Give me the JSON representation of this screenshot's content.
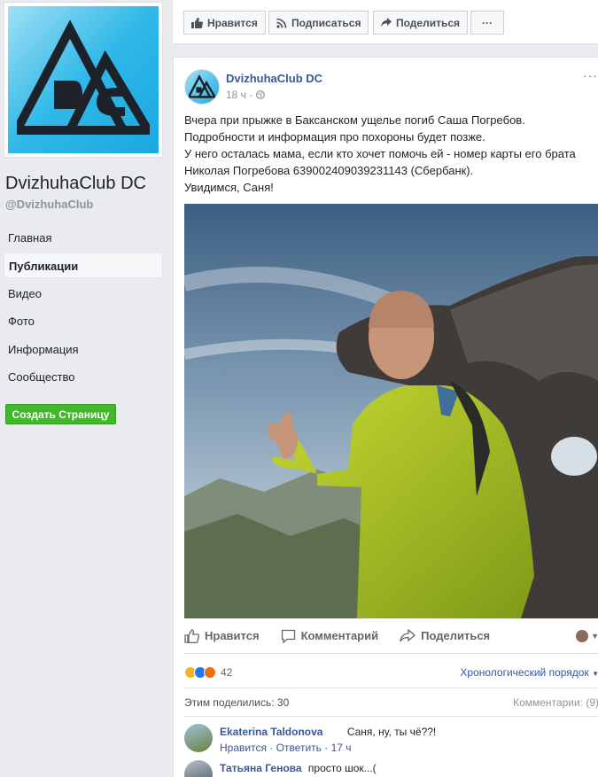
{
  "sidebar": {
    "page_name": "DvizhuhaClub DC",
    "handle": "@DvizhuhaClub",
    "nav": [
      "Главная",
      "Публикации",
      "Видео",
      "Фото",
      "Информация",
      "Сообщество"
    ],
    "active_index": 1,
    "create_label": "Создать Страницу"
  },
  "actions": {
    "like": "Нравится",
    "follow": "Подписаться",
    "share": "Поделиться",
    "more": "···"
  },
  "post": {
    "author": "DvizhuhaClub DC",
    "time": "18 ч ·",
    "lines": [
      "Вчера при прыжке в Баксанском ущелье погиб Саша Погребов.",
      "Подробности и информация про похороны будет позже.",
      "У него осталась мама, если кто хочет помочь ей - номер карты его брата",
      "Николая Погребова 639002409039231143 (Сбербанк).",
      "Увидимся, Саня!"
    ],
    "footer": {
      "like": "Нравится",
      "comment": "Комментарий",
      "share": "Поделиться"
    },
    "reaction_count": "42",
    "order_label": "Хронологический порядок",
    "shares_label": "Этим поделились: 30",
    "comments_label": "Комментарии: (9)"
  },
  "comments": [
    {
      "name": "Ekaterina Taldonova",
      "text": "Саня, ну, ты чё??!",
      "meta": "Нравится · Ответить · 17 ч"
    },
    {
      "name": "Татьяна Генова",
      "text": "просто шок...(",
      "meta": ""
    }
  ],
  "colors": {
    "link": "#385898",
    "green": "#42b72a",
    "bg": "#e9ebee"
  }
}
